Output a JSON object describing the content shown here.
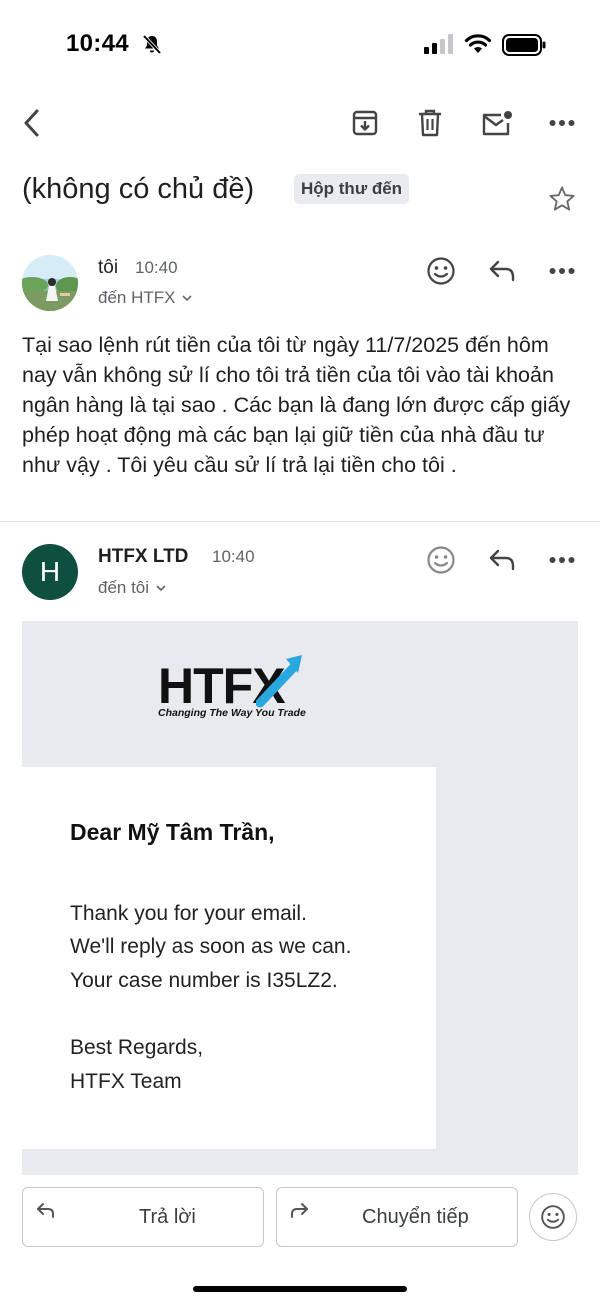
{
  "status_bar": {
    "time": "10:44"
  },
  "subject": {
    "title": "(không có chủ đề)",
    "label": "Hộp thư đến"
  },
  "messages": [
    {
      "sender": "tôi",
      "time": "10:40",
      "recipient": "đến HTFX",
      "body": "Tại sao lệnh rút tiền của tôi từ ngày 11/7/2025 đến hôm nay vẫn không sử lí cho tôi trả tiền của tôi vào tài khoản ngân hàng là tại sao  . Các bạn là đang lớn được cấp giấy phép hoạt động mà các bạn lại giữ tiền của nhà đầu tư như vậy . Tôi yêu cầu sử lí trả lại tiền cho tôi ."
    },
    {
      "sender": "HTFX LTD",
      "avatar_letter": "H",
      "time": "10:40",
      "recipient": "đến tôi",
      "avatar_color": "#0e4f3f"
    }
  ],
  "email_card": {
    "logo_text": "HTFX",
    "logo_tagline": "Changing The Way You Trade",
    "greeting": "Dear Mỹ Tâm Trần,",
    "lines": [
      "Thank you for your email.",
      "We'll reply as soon as we can.",
      "Your case number is I35LZ2."
    ],
    "signoff": [
      "Best Regards,",
      "HTFX Team"
    ],
    "accent_color": "#29a8e0"
  },
  "actions": {
    "reply": "Trả lời",
    "forward": "Chuyển tiếp"
  }
}
